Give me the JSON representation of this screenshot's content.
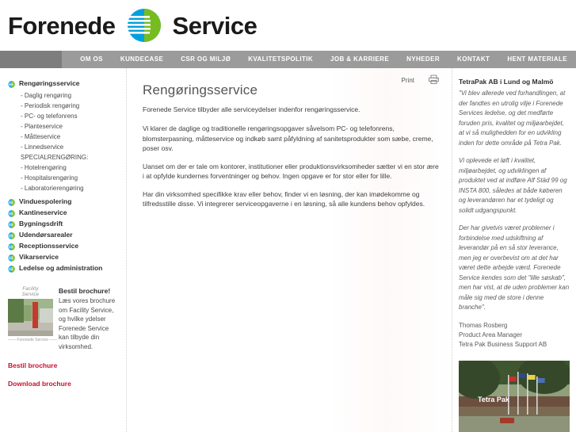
{
  "header": {
    "logo_text_left": "Forenede",
    "logo_text_right": "Service",
    "logo_mark_name": "forenede-service-logo-mark"
  },
  "nav": {
    "items": [
      {
        "label": "OM OS"
      },
      {
        "label": "KUNDECASE"
      },
      {
        "label": "CSR OG MILJØ"
      },
      {
        "label": "KVALITETSPOLITIK"
      },
      {
        "label": "JOB & KARRIERE"
      },
      {
        "label": "NYHEDER"
      },
      {
        "label": "KONTAKT"
      },
      {
        "label": "HENT MATERIALE"
      }
    ]
  },
  "sidebar": {
    "groups": [
      {
        "label": "Rengøringsservice",
        "sub": [
          "- Daglig rengøring",
          "- Periodisk rengøring",
          "- PC- og telefonrens",
          "- Planteservice",
          "- Måtteservice",
          "- Linnedservice",
          "SPECIALRENGØRING:",
          "- Hotelrengøring",
          "- Hospitalsrengøring",
          "- Laboratorierengøring"
        ]
      },
      {
        "label": "Vinduespolering",
        "sub": []
      },
      {
        "label": "Kantineservice",
        "sub": []
      },
      {
        "label": "Bygningsdrift",
        "sub": []
      },
      {
        "label": "Udendørsarealer",
        "sub": []
      },
      {
        "label": "Receptionsservice",
        "sub": []
      },
      {
        "label": "Vikarservice",
        "sub": []
      },
      {
        "label": "Ledelse og administration",
        "sub": []
      }
    ],
    "brochure": {
      "thumb_caption_line1": "Facility",
      "thumb_caption_line2": "Service",
      "thumb_footer": "—— Forenede  Service ——",
      "title": "Bestil brochure!",
      "body": "Læs vores brochure om Facility Service, og hvilke ydelser Forenede Service kan tilbyde din virksomhed.",
      "link_order": "Bestil brochure",
      "link_download": "Download brochure",
      "link_color": "#c8102e"
    }
  },
  "main": {
    "print_label": "Print",
    "title": "Rengøringsservice",
    "lede": "Forenede Service tilbyder alle serviceydelser indenfor rengøringsservice.",
    "paragraphs": [
      "Vi klarer de daglige og traditionelle rengøringsopgaver såvelsom PC- og telefonrens, blomsterpasning, måtteservice og indkøb samt påfyldning af sanitetsprodukter som sæbe, creme, poser osv.",
      "Uanset om der er tale om kontorer, institutioner eller produktionsvirksomheder sætter vi en stor ære i at opfylde kundernes forventninger og behov. Ingen opgave er for stor eller for lille.",
      "Har din virksomhed specifikke krav eller behov, finder vi en løsning, der kan imødekomme og tilfredsstille disse. Vi integrerer serviceopgaverne i en løsning, så alle kundens behov opfyldes."
    ]
  },
  "right": {
    "quote_title": "TetraPak AB i Lund og Malmö",
    "quote_paragraphs": [
      "\"Vi blev allerede ved forhandlingen, at der fandtes en utrolig vilje i Forenede Services ledelse, og det medførte foruden pris, kvalitet og miljøarbejdet, at vi så mulighedden for en udvikling inden for dette område på Tetra Pak.",
      "Vi oplevede et løft i kvalitet, miljøarbejdet, og udviklingen af produktet ved at indføre Alf Städ 99 og INSTA 800, således at både køberen og leverandøren har et tydeligt og solidt udgangspunkt.",
      "Der har givetvis været problemer i forbindelse med udskiftning af leverandør på en så stor leverance, men jeg er overbevist om at det har været dette arbejde værd. Forenede Service kendes som det \"lille søskab\", men har vist, at de uden problemer kan måle sig med de store i denne branche\"."
    ],
    "signature": [
      "Thomas Rosberg",
      "Product Area Manager",
      "Tetra Pak Business Support AB"
    ],
    "photo_caption": "Tetra Pak",
    "photo_name": "tetra-pak-building-photo"
  }
}
